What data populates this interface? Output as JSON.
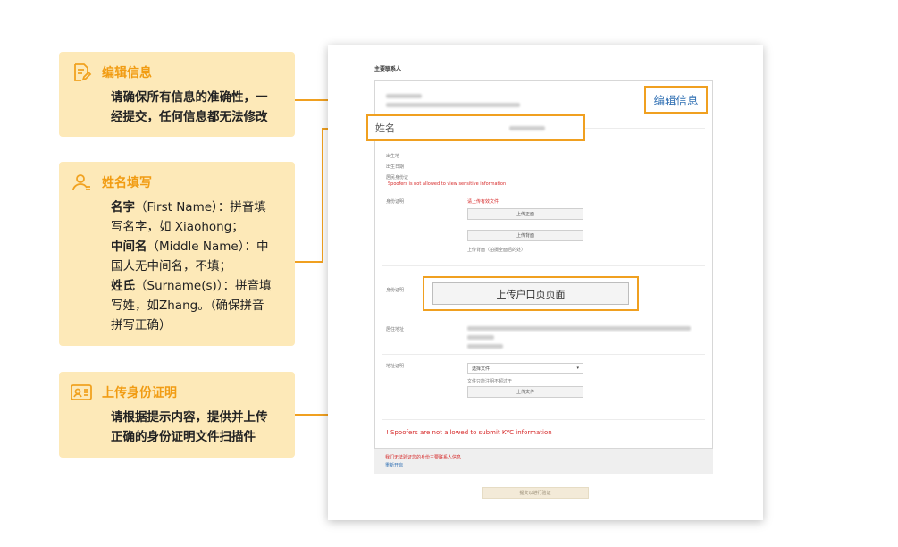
{
  "cards": [
    {
      "icon": "edit-document-icon",
      "title": "编辑信息",
      "lines": [
        "请确保所有信息的准确性，一",
        "经提交，任何信息都无法修改"
      ]
    },
    {
      "icon": "person-icon",
      "title": "姓名填写",
      "lines": [
        {
          "b": "名字",
          "n": "（First Name）：拼音填"
        },
        {
          "b": "",
          "n": "写名字，如 Xiaohong；"
        },
        {
          "b": "中间名",
          "n": "（Middle Name）：中"
        },
        {
          "b": "",
          "n": "国人无中间名，不填；"
        },
        {
          "b": "姓氏",
          "n": "（Surname(s)）：拼音填"
        },
        {
          "b": "",
          "n": "写姓，如Zhang。（确保拼音"
        },
        {
          "b": "",
          "n": "拼写正确）"
        }
      ]
    },
    {
      "icon": "id-card-icon",
      "title": "上传身份证明",
      "lines": [
        "请根据提示内容，提供并上传",
        "正确的身份证明文件扫描件"
      ]
    }
  ],
  "screenshot": {
    "section_title": "主要联系人",
    "edit_button": "编辑信息",
    "name_label": "姓名",
    "spoofer_warning_small": "Spoofers is not allowed to view sensitive information",
    "upload_tip": "请上传有效文件",
    "upload_front": "上传正面",
    "upload_back": "上传背面",
    "upload_hint": "上传背面（拍摄全面后的处）",
    "upload_household": "上传户口页页面",
    "select_value": "选择文件",
    "select_hint_prefix": "文件只能注明不超过于",
    "upload_file": "上传文件",
    "kyc_warning": "Spoofers are not allowed to submit KYC information",
    "bottom_warning": "我们无法验证您的身份主要联系人信息",
    "bottom_link": "重新开启",
    "submit_label": "提交以进行验证",
    "field_labels": [
      "出生地",
      "出生日期",
      "居民身份证",
      "身份证明",
      "身份证明",
      "居住地址",
      "地址证明"
    ]
  }
}
